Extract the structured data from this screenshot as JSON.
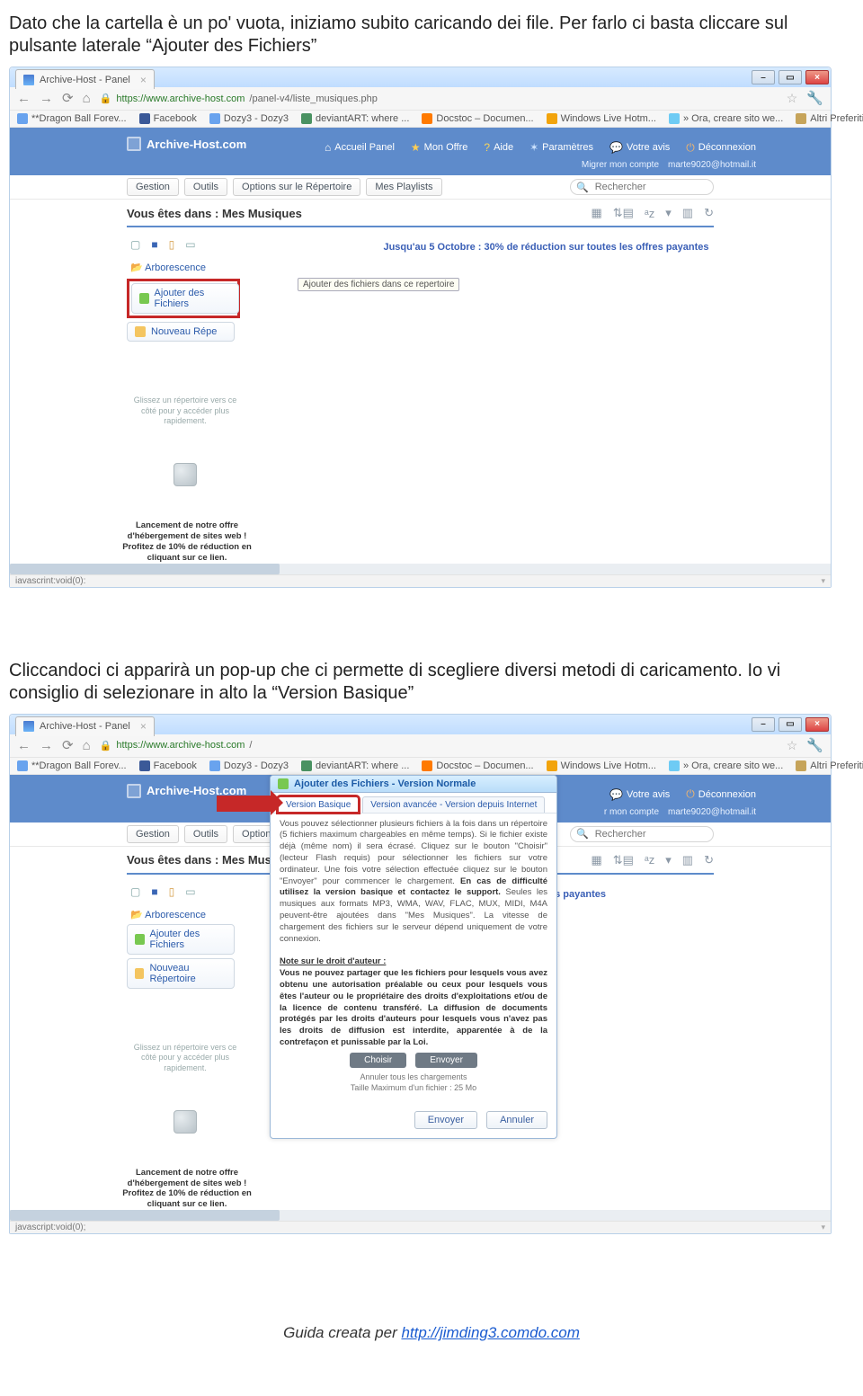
{
  "doc": {
    "para1": "Dato che la cartella è un po' vuota, iniziamo subito caricando dei file. Per farlo ci basta cliccare sul pulsante laterale “Ajouter des Fichiers”",
    "para2": "Cliccandoci ci apparirà un pop-up che ci permette di scegliere diversi metodi di caricamento. Io vi consiglio di selezionare in alto la “Version Basique”",
    "footer_prefix": "Guida creata per ",
    "footer_link_text": "http://jimding3.comdo.com"
  },
  "shared": {
    "tab_title": "Archive-Host - Panel",
    "bookmarks": {
      "dragon": "**Dragon Ball Forev...",
      "fb": "Facebook",
      "dozy": "Dozy3 - Dozy3",
      "da": "deviantART: where ...",
      "docstoc": "Docstoc – Documen...",
      "winlive": "Windows Live Hotm...",
      "ora": "» Ora, creare sito we...",
      "altri": "Altri Preferiti"
    },
    "brand": "Archive-Host.com",
    "top_links": {
      "accueil": "Accueil Panel",
      "offre": "Mon Offre",
      "aide": "Aide",
      "param": "Paramètres",
      "avis": "Votre avis",
      "decon": "Déconnexion"
    },
    "acct": {
      "migrer": "Migrer mon compte",
      "email": "marte9020@hotmail.it"
    },
    "toolbar": {
      "gestion": "Gestion",
      "outils": "Outils",
      "options": "Options sur le Répertoire",
      "playlists": "Mes Playlists"
    },
    "search_placeholder": "Rechercher",
    "breadcrumb": "Vous êtes dans : Mes Musiques",
    "sidebar": {
      "arbo": "Arborescence",
      "ajouter": "Ajouter des Fichiers",
      "nouveau_full": "Nouveau Répertoire",
      "nouveau_cut": "Nouveau Répe",
      "drag_hint": "Glissez un répertoire vers ce côté pour y accéder plus rapidement.",
      "lance_l1": "Lancement de notre offre",
      "lance_l2": "d'hébergement de sites web !",
      "lance_l3": "Profitez de 10% de réduction en",
      "lance_l4": "cliquant sur ce lien."
    },
    "promo": "Jusqu'au 5 Octobre : 30% de réduction sur toutes les offres payantes",
    "promo_cut": "es payantes",
    "tooltip": "Ajouter des fichiers dans ce repertoire"
  },
  "ss1": {
    "url_host": "https://www.archive-host.com",
    "url_path": "/panel-v4/liste_musiques.php",
    "status": "iavascrint:void(0):"
  },
  "ss2": {
    "url_host": "https://www.archive-host.com",
    "url_path": "/",
    "status": "javascript:void(0);",
    "breadcrumb_cut": "Vous êtes dans : Mes Musi",
    "toolbar_options_cut": "Options sur le",
    "dialog": {
      "title": "Ajouter des Fichiers - Version Normale",
      "tab_basique": "Version Basique",
      "tab_avancee": "Version avancée - Version depuis Internet",
      "body_1": "Vous pouvez sélectionner plusieurs fichiers à la fois dans un répertoire (5 fichiers maximum chargeables en même temps). Si le fichier existe déjà (même nom) il sera écrasé. Cliquez sur le bouton \"Choisir\" (lecteur Flash requis) pour sélectionner les fichiers sur votre ordinateur. Une fois votre sélection effectuée cliquez sur le bouton \"Envoyer\" pour commencer le chargement. ",
      "body_bold": "En cas de difficulté utilisez la version basique et contactez le support.",
      "body_2": " Seules les musiques aux formats MP3, WMA, WAV, FLAC, MUX, MIDI, M4A peuvent-être ajoutées dans \"Mes Musiques\". La vitesse de chargement des fichiers sur le serveur dépend uniquement de votre connexion.",
      "note_title": "Note sur le droit d'auteur :",
      "note_body": "Vous ne pouvez partager que les fichiers pour lesquels vous avez obtenu une autorisation préalable ou ceux pour lesquels vous êtes l'auteur ou le propriétaire des droits d'exploitations et/ou de la licence de contenu transféré. La diffusion de documents protégés par les droits d'auteurs pour lesquels vous n'avez pas les droits de diffusion est interdite, apparentée à de la contrefaçon et punissable par la Loi.",
      "btn_choisir": "Choisir",
      "btn_envoyer": "Envoyer",
      "annuler_all": "Annuler tous les chargements",
      "taille": "Taille Maximum d'un fichier : 25 Mo",
      "foot_envoyer": "Envoyer",
      "foot_annuler": "Annuler"
    }
  }
}
